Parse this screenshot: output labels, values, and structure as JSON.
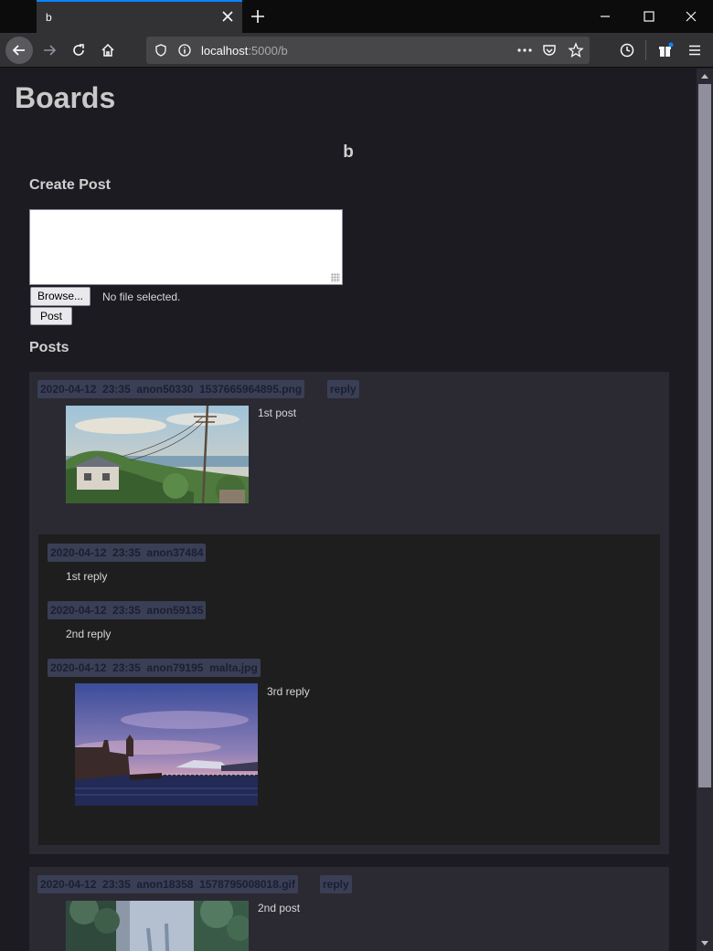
{
  "browser": {
    "tab_title": "b",
    "url_host": "localhost",
    "url_rest": ":5000/b"
  },
  "page": {
    "site_title": "Boards",
    "board_name": "b",
    "create_post_heading": "Create Post",
    "browse_label": "Browse...",
    "file_status": "No file selected.",
    "post_button": "Post",
    "posts_heading": "Posts"
  },
  "posts": [
    {
      "meta": "2020-04-12  23:35  anon50330  1537665964895.png",
      "reply_label": "reply",
      "text": "1st post",
      "replies": [
        {
          "meta": "2020-04-12  23:35  anon37484",
          "text": "1st reply"
        },
        {
          "meta": "2020-04-12  23:35  anon59135",
          "text": "2nd reply"
        },
        {
          "meta": "2020-04-12  23:35  anon79195  malta.jpg",
          "text": "3rd reply"
        }
      ]
    },
    {
      "meta": "2020-04-12  23:35  anon18358  1578795008018.gif",
      "reply_label": "reply",
      "text": "2nd post"
    }
  ]
}
